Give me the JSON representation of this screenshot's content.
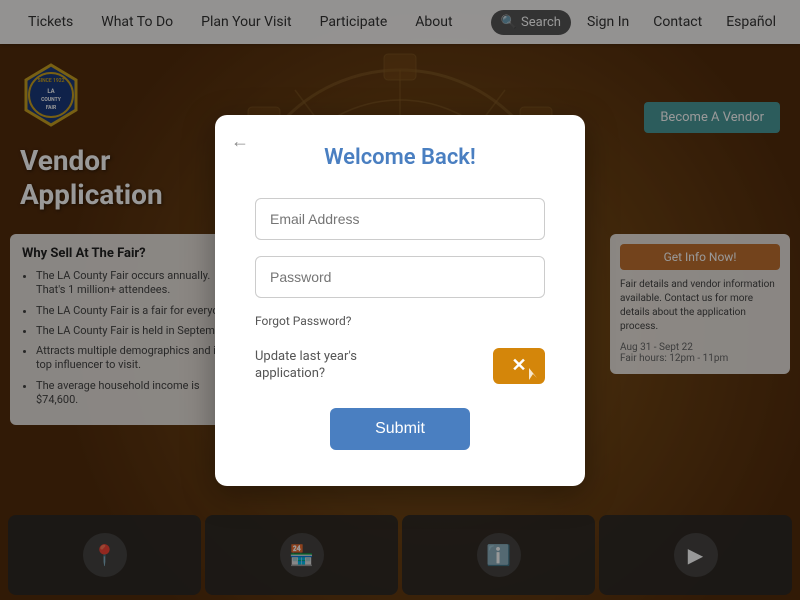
{
  "navbar": {
    "links": [
      {
        "id": "tickets",
        "label": "Tickets"
      },
      {
        "id": "what-to-do",
        "label": "What To Do"
      },
      {
        "id": "plan-your-visit",
        "label": "Plan Your Visit"
      },
      {
        "id": "participate",
        "label": "Participate"
      },
      {
        "id": "about",
        "label": "About"
      }
    ],
    "search_label": "Search",
    "signin_label": "Sign In",
    "contact_label": "Contact",
    "language_label": "Español"
  },
  "page": {
    "title_line1": "Vendor",
    "title_line2": "Application",
    "become_vendor_label": "Become A Vendor",
    "why_sell_title": "Why Sell At The Fair?",
    "why_sell_items": [
      "The LA County Fair occurs annually. That's 1 million+ attendees.",
      "The LA County Fair is a fair for everyone.",
      "The LA County Fair is held in September.",
      "Attracts multiple demographics and is a top influencer to visit.",
      "The average household income is $74,600."
    ],
    "get_info_label": "Get Info Now!",
    "bottom_icons": [
      {
        "id": "location",
        "symbol": "📍"
      },
      {
        "id": "shop",
        "symbol": "🏪"
      },
      {
        "id": "info",
        "symbol": "ℹ️"
      },
      {
        "id": "play",
        "symbol": "▶"
      }
    ]
  },
  "modal": {
    "back_symbol": "←",
    "title": "Welcome Back!",
    "email_placeholder": "Email Address",
    "password_placeholder": "Password",
    "forgot_password_label": "Forgot Password?",
    "update_label": "Update last year's\napplication?",
    "submit_label": "Submit"
  },
  "logo": {
    "badge_text": "LA COUNTY FAIR",
    "since": "SINCE 1922"
  }
}
